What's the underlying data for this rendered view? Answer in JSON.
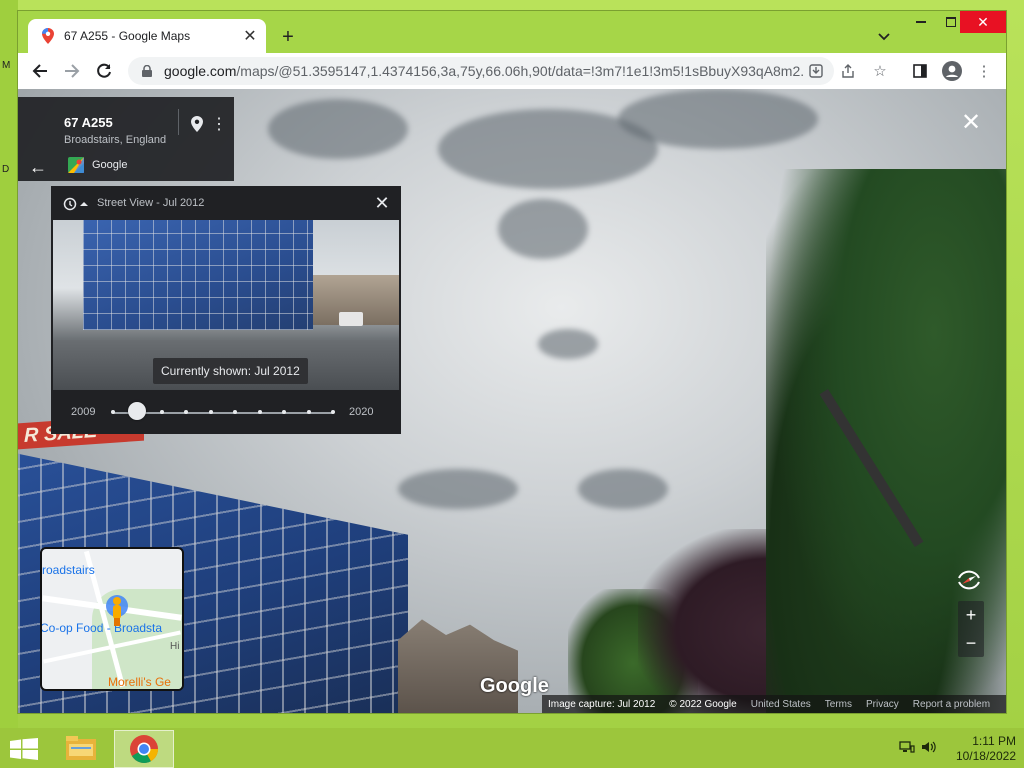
{
  "desktop": {
    "left_labels": [
      "M",
      "D"
    ]
  },
  "browser": {
    "tab_title": "67 A255 - Google Maps",
    "url_host": "google.com",
    "url_path": "/maps/@51.3595147,1.4374156,3a,75y,66.06h,90t/data=!3m7!1e1!3m5!1sBbuyX93qA8m2..."
  },
  "place": {
    "name": "67 A255",
    "subtitle": "Broadstairs, England",
    "source": "Google"
  },
  "timeline": {
    "title": "Street View - Jul 2012",
    "tooltip": "Currently shown: Jul 2012",
    "start_year": "2009",
    "end_year": "2020",
    "tick_count": 10,
    "selected_index": 1
  },
  "scene": {
    "sign_text": "R SALE"
  },
  "minimap": {
    "labels": [
      "roadstairs",
      "Co-op Food - Broadsta",
      "Morelli's Ge",
      "Hi"
    ]
  },
  "map_logo": "Google",
  "footer": {
    "capture": "Image capture: Jul 2012",
    "copyright": "© 2022 Google",
    "region": "United States",
    "terms": "Terms",
    "privacy": "Privacy",
    "report": "Report a problem"
  },
  "taskbar": {
    "time": "1:11 PM",
    "date": "10/18/2022"
  },
  "colors": {
    "accent": "#a6d648",
    "panel": "#202124",
    "close_red": "#e81123"
  }
}
